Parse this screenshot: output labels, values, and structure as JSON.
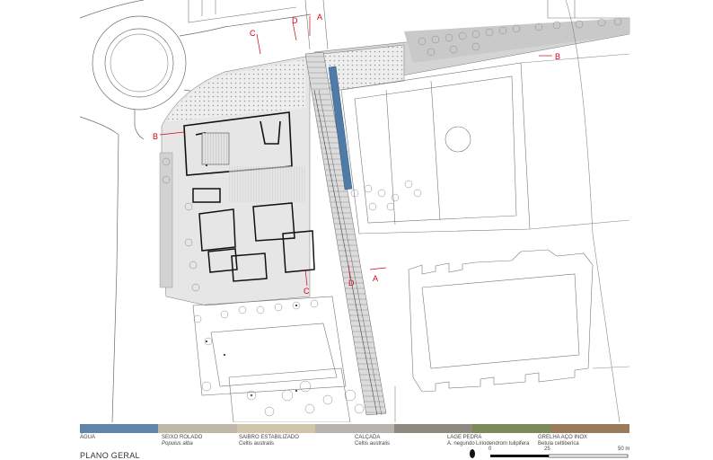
{
  "title": "PLANO GERAL",
  "section_markers": [
    "A",
    "B",
    "C",
    "D"
  ],
  "legend": [
    {
      "id": "agua",
      "label": "ÁGUA",
      "species": "",
      "color": "#5f86a8"
    },
    {
      "id": "seixo",
      "label": "SEIXO ROLADO",
      "species": "Populus alba",
      "color": "#bfb8a8"
    },
    {
      "id": "saibro",
      "label": "SAIBRO ESTABILIZADO",
      "species": "Celtis australis",
      "color": "#cfc5a8"
    },
    {
      "id": "calcada",
      "label": "CALÇADA",
      "species": "Celtis australis",
      "color": "#b8b4ad"
    },
    {
      "id": "lage",
      "label": "LAGE PEDRA",
      "species": "A. negundo",
      "color": "#8e8a80"
    },
    {
      "id": "lirio",
      "label": "",
      "species": "Liriodendrom tulipifera",
      "color": "#7c8a5a"
    },
    {
      "id": "grelha",
      "label": "GRELHA AÇO INOX",
      "species": "Betula celtiberica",
      "color": "#9a7a5a"
    }
  ],
  "scale": {
    "ticks": [
      "0",
      "25",
      "50 m"
    ]
  },
  "colors": {
    "line": "#555555",
    "section": "#d0021b",
    "water": "#4f7ba6",
    "grass": "#d9d9d9"
  }
}
